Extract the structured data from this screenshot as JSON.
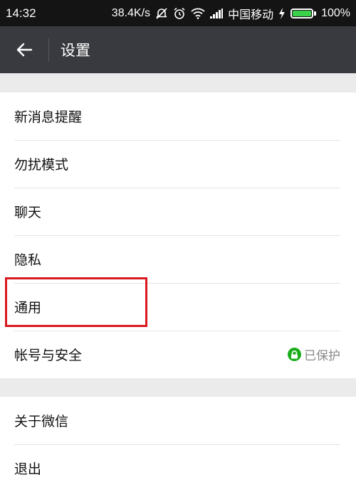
{
  "status_bar": {
    "time": "14:32",
    "net_speed": "38.4K/s",
    "carrier": "中国移动",
    "battery": "100%",
    "battery_level": 1.0,
    "icons": [
      "mute-icon",
      "alarm-icon",
      "wifi-icon",
      "signal-icon",
      "charging-icon",
      "battery-icon"
    ]
  },
  "header": {
    "back_icon": "back-arrow-icon",
    "title": "设置"
  },
  "settings": {
    "group1": [
      {
        "label": "新消息提醒"
      },
      {
        "label": "勿扰模式"
      },
      {
        "label": "聊天"
      },
      {
        "label": "隐私"
      },
      {
        "label": "通用"
      },
      {
        "label": "帐号与安全",
        "status": "已保护",
        "status_icon": "lock-icon"
      }
    ],
    "group2": [
      {
        "label": "关于微信"
      },
      {
        "label": "退出"
      }
    ]
  },
  "colors": {
    "status_bar_bg": "#141414",
    "title_bar_bg": "#393a3f",
    "page_bg": "#ebebeb",
    "accent_green": "#1aad19",
    "highlight_red": "#d9191f"
  }
}
